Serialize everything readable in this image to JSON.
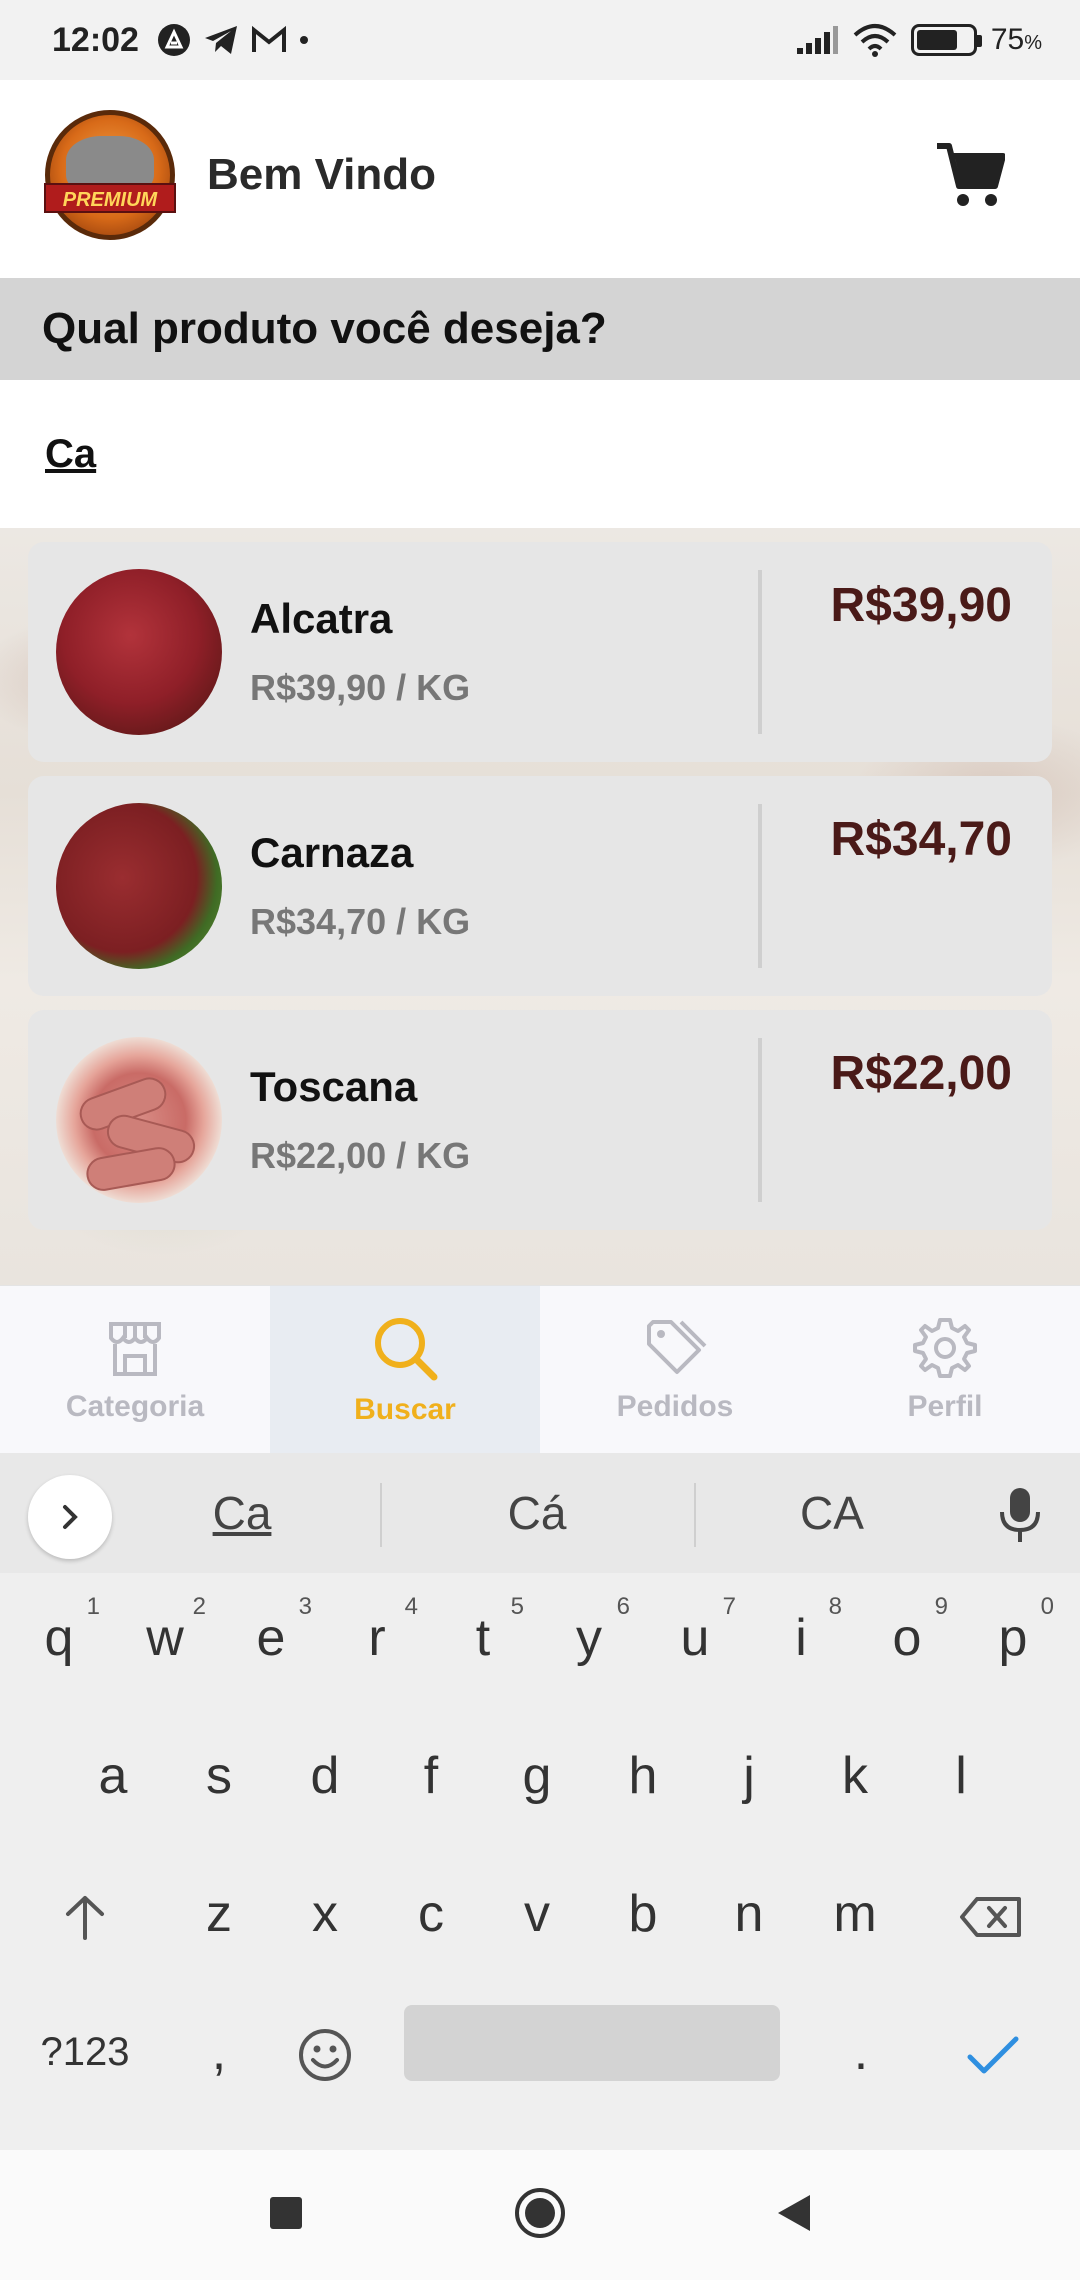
{
  "status": {
    "time": "12:02",
    "battery": "75",
    "battery_unit": "%",
    "battery_level": 0.75
  },
  "header": {
    "logo_text": "PREMIUM",
    "welcome": "Bem Vindo"
  },
  "section_title": "Qual produto você deseja?",
  "search": {
    "value": "Ca"
  },
  "products": [
    {
      "name": "Alcatra",
      "unit_price": "R$39,90 / KG",
      "price": "R$39,90"
    },
    {
      "name": "Carnaza",
      "unit_price": "R$34,70 / KG",
      "price": "R$34,70"
    },
    {
      "name": "Toscana",
      "unit_price": "R$22,00 / KG",
      "price": "R$22,00"
    }
  ],
  "nav": {
    "items": [
      {
        "label": "Categoria",
        "icon": "store-icon"
      },
      {
        "label": "Buscar",
        "icon": "search-icon"
      },
      {
        "label": "Pedidos",
        "icon": "tag-icon"
      },
      {
        "label": "Perfil",
        "icon": "gear-icon"
      }
    ],
    "active": "Buscar",
    "active_color": "#f0b01c",
    "inactive_color": "#b9b9c1"
  },
  "keyboard": {
    "suggestions": [
      "Ca",
      "Cá",
      "CA"
    ],
    "row1": [
      {
        "k": "q",
        "n": "1"
      },
      {
        "k": "w",
        "n": "2"
      },
      {
        "k": "e",
        "n": "3"
      },
      {
        "k": "r",
        "n": "4"
      },
      {
        "k": "t",
        "n": "5"
      },
      {
        "k": "y",
        "n": "6"
      },
      {
        "k": "u",
        "n": "7"
      },
      {
        "k": "i",
        "n": "8"
      },
      {
        "k": "o",
        "n": "9"
      },
      {
        "k": "p",
        "n": "0"
      }
    ],
    "row2": [
      "a",
      "s",
      "d",
      "f",
      "g",
      "h",
      "j",
      "k",
      "l"
    ],
    "row3": [
      "z",
      "x",
      "c",
      "v",
      "b",
      "n",
      "m"
    ],
    "symbols_key": "?123",
    "comma_key": ",",
    "period_key": ".",
    "accent_color": "#2f8fe0"
  },
  "colors": {
    "price": "#4a1a18",
    "title_band": "#d4d4d4",
    "card": "#e6e6e6"
  }
}
